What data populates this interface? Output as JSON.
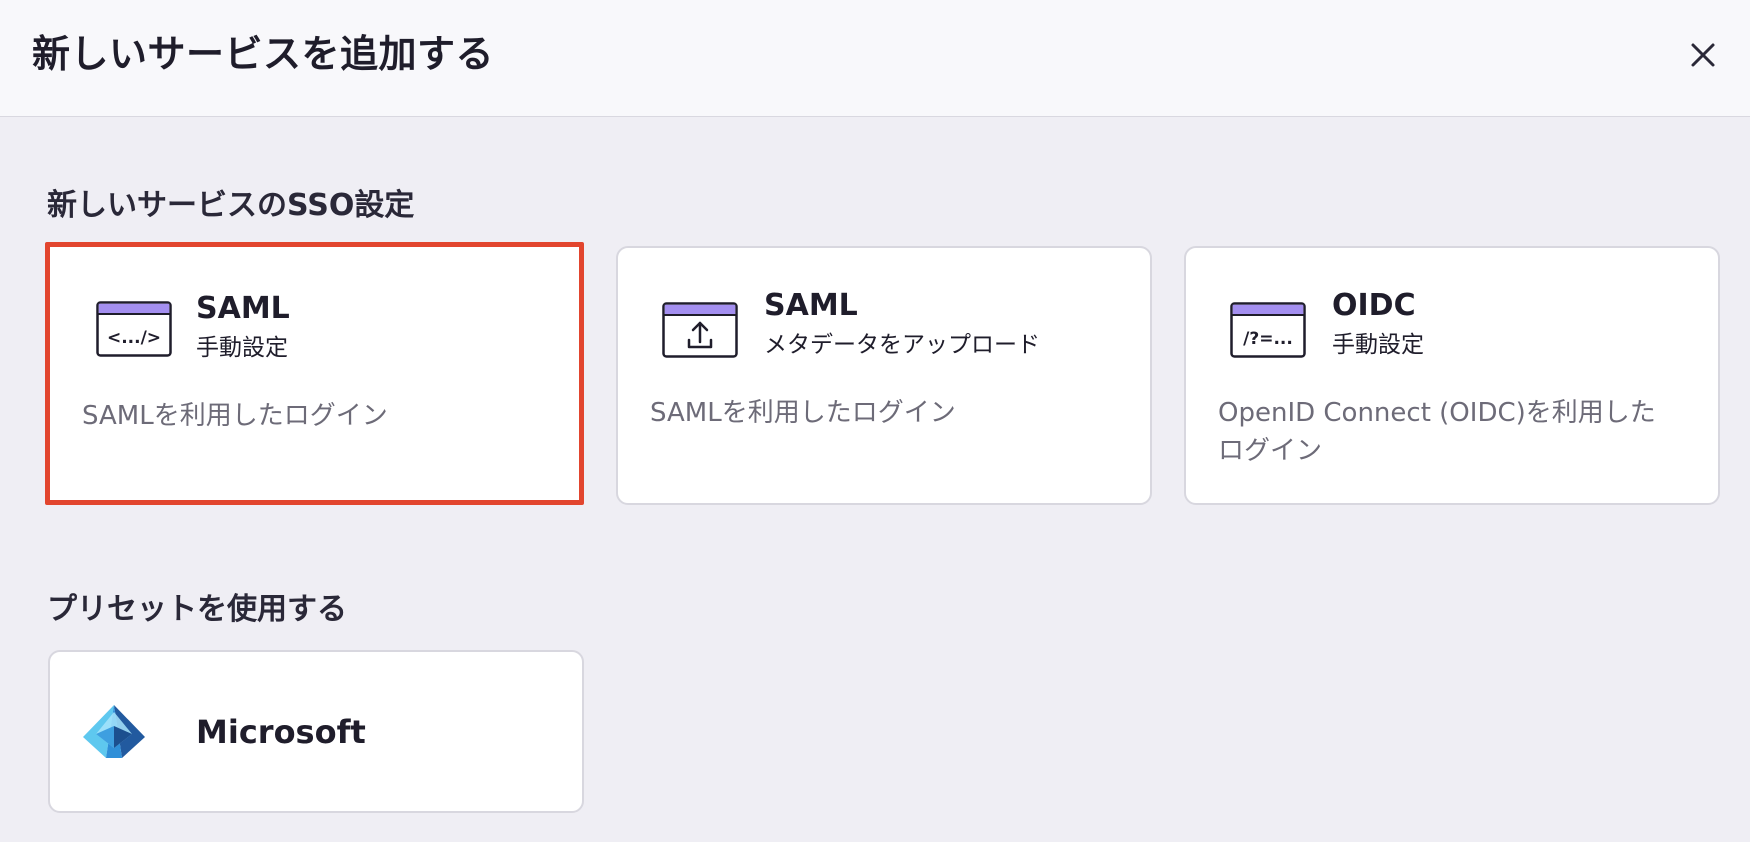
{
  "dialog": {
    "title": "新しいサービスを追加する",
    "close_icon": "close-icon"
  },
  "sso_section": {
    "title": "新しいサービスのSSO設定",
    "cards": [
      {
        "title": "SAML",
        "subtitle": "手動設定",
        "description": "SAMLを利用したログイン",
        "icon": "code-window-icon",
        "icon_glyph": "<.../>",
        "selected": true
      },
      {
        "title": "SAML",
        "subtitle": "メタデータをアップロード",
        "description": "SAMLを利用したログイン",
        "icon": "upload-window-icon",
        "selected": false
      },
      {
        "title": "OIDC",
        "subtitle": "手動設定",
        "description": "OpenID Connect (OIDC)を利用したログイン",
        "icon": "query-window-icon",
        "icon_glyph": "/?=...",
        "selected": false
      }
    ]
  },
  "preset_section": {
    "title": "プリセットを使用する",
    "presets": [
      {
        "label": "Microsoft",
        "icon": "azure-ad-logo-icon"
      }
    ]
  },
  "colors": {
    "accent_purple": "#a48ff0",
    "selected_border": "#e2452e",
    "background": "#efeef4"
  }
}
